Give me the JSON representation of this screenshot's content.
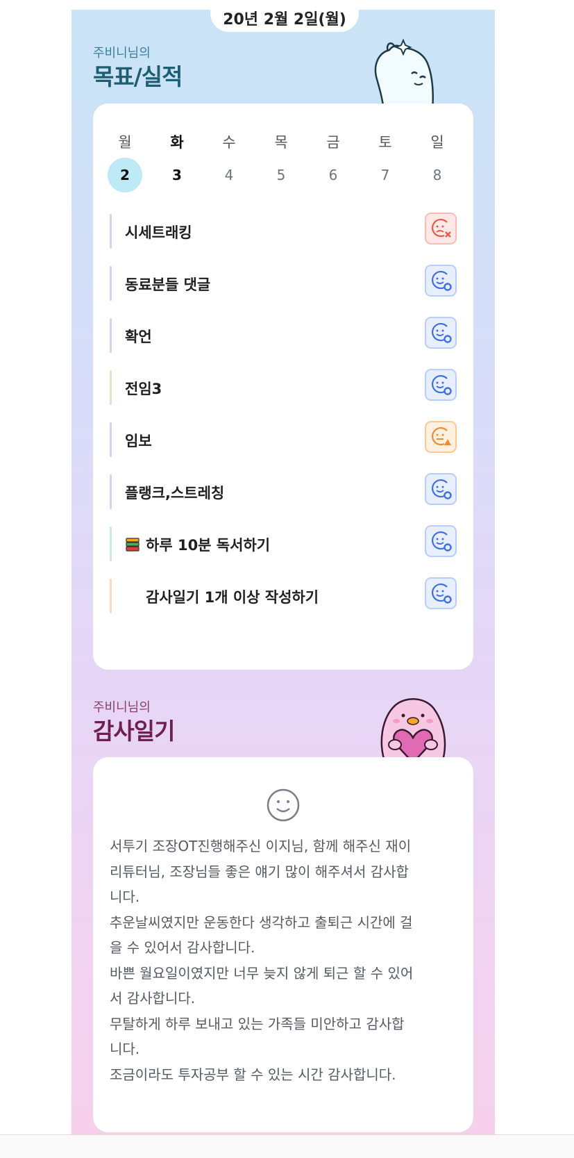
{
  "header": {
    "date_partial": "20년 2월 2일(월)"
  },
  "goals_section": {
    "owner_label": "주비니님의",
    "title": "목표/실적"
  },
  "week": {
    "day_names": [
      "월",
      "화",
      "수",
      "목",
      "금",
      "토",
      "일"
    ],
    "day_numbers": [
      "2",
      "3",
      "4",
      "5",
      "6",
      "7",
      "8"
    ],
    "selected_index": 0,
    "today_index": 1
  },
  "goals": [
    {
      "label": "시세트래킹",
      "status": "bad",
      "bar_color": "#cfd6ee"
    },
    {
      "label": "동료분들 댓글",
      "status": "good",
      "bar_color": "#cfd6ee"
    },
    {
      "label": "확언",
      "status": "good",
      "bar_color": "#cfd6ee"
    },
    {
      "label": "전임3",
      "status": "good",
      "bar_color": "#d6e9c4"
    },
    {
      "label": "임보",
      "status": "warn",
      "bar_color": "#cfd6ee"
    },
    {
      "label": "플랭크,스트레칭",
      "status": "good",
      "bar_color": "#cfd6ee"
    },
    {
      "label": "하루 10분 독서하기",
      "status": "good",
      "bar_color": "#c6ecde"
    },
    {
      "label": "감사일기 1개 이상 작성하기",
      "status": "good",
      "bar_color": "#f8dcc2"
    }
  ],
  "diary_section": {
    "owner_label": "주비니님의",
    "title": "감사일기",
    "text": "서투기 조장OT진행해주신 이지님, 함께 해주신 재이\n리튜터님, 조장님들 좋은 얘기 많이 해주셔서 감사합\n니다.\n추운날씨였지만 운동한다 생각하고 출퇴근 시간에 걸\n을 수 있어서 감사합니다.\n바쁜 월요일이였지만 너무 늦지 않게 퇴근 할 수 있어\n서 감사합니다.\n무탈하게 하루 보내고 있는 가족들 미안하고 감사합\n니다.\n조금이라도 투자공부 할 수 있는 시간 감사합니다."
  },
  "icons": {
    "good": "smile-check-icon",
    "bad": "sad-x-icon",
    "warn": "smile-warning-icon",
    "mood": "smile-face-icon",
    "book": "books-icon"
  },
  "colors": {
    "good": "#3f6fe0",
    "bad": "#e8594c",
    "warn": "#f08c2e",
    "accent_selected_day": "#bdeaf6",
    "title_blue": "#1d5e73",
    "title_plum": "#6e1f4f"
  }
}
